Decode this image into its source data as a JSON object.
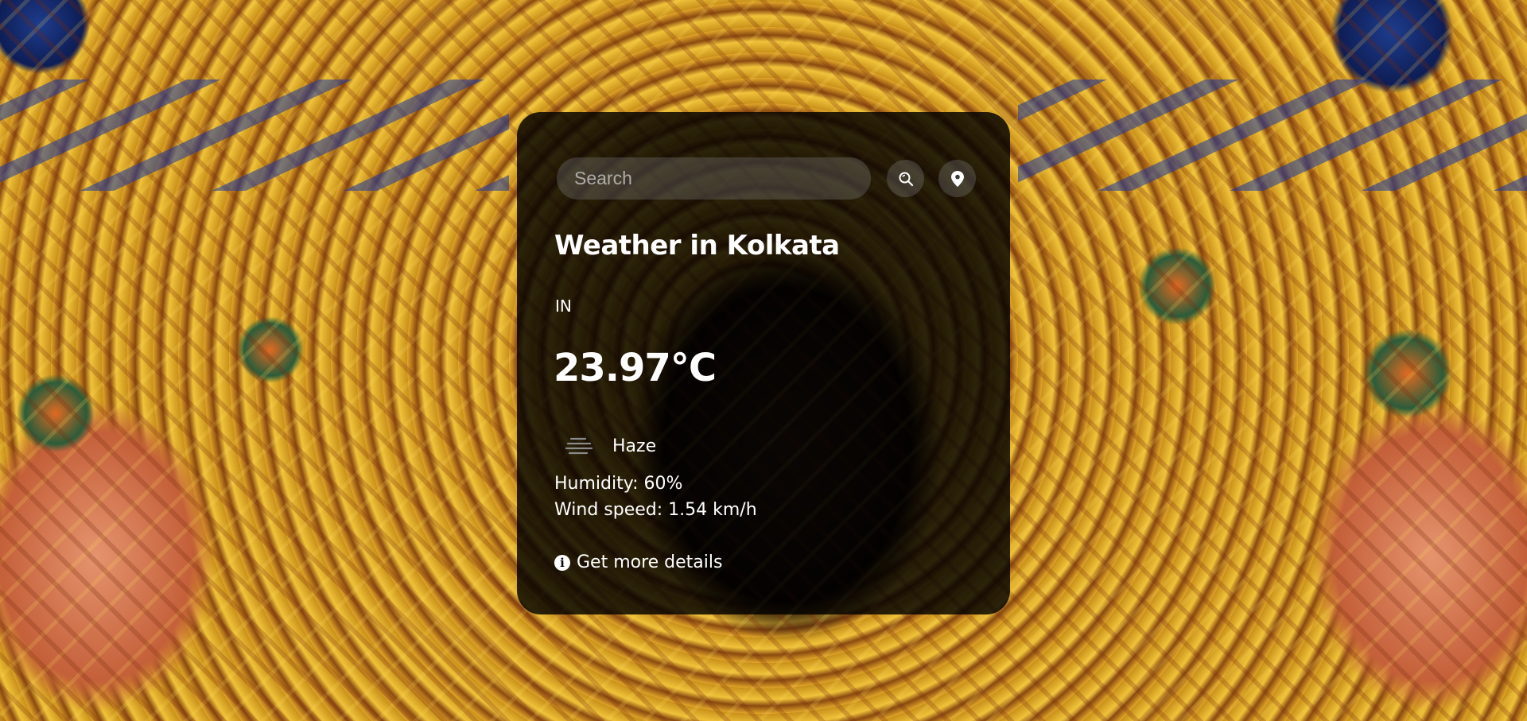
{
  "search": {
    "placeholder": "Search",
    "value": ""
  },
  "icons": {
    "search_button": "search-icon",
    "location_button": "location-pin-icon",
    "condition": "haze-icon",
    "info": "info-icon"
  },
  "weather": {
    "title": "Weather in Kolkata",
    "country": "IN",
    "temperature": "23.97°C",
    "condition": "Haze",
    "humidity": "Humidity: 60%",
    "wind": "Wind speed: 1.54 km/h"
  },
  "details_link": "Get more details",
  "colors": {
    "card_background": "#000000",
    "text": "#ffffff"
  }
}
